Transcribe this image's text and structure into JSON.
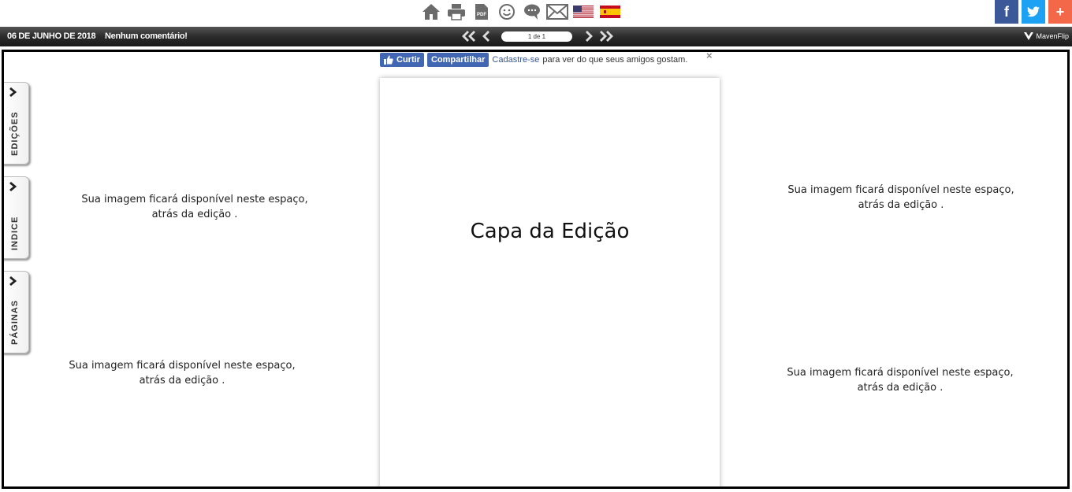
{
  "toolbar": {
    "icons": [
      "home-icon",
      "print-icon",
      "pdf-icon",
      "smiley-icon",
      "comments-icon",
      "mail-icon"
    ],
    "pdf_label": "PDF",
    "flags": [
      "us-flag",
      "es-flag"
    ]
  },
  "social": {
    "facebook": "f",
    "twitter": "t",
    "more": "+",
    "colors": {
      "facebook": "#3b5998",
      "twitter": "#1da1f2",
      "more": "#f26849"
    }
  },
  "navbar": {
    "date": "06 DE JUNHO DE 2018",
    "comments": "Nenhum comentário!",
    "page_indicator": "1 de 1",
    "brand": "MavenFlip"
  },
  "facebook_bar": {
    "like_label": "Curtir",
    "share_label": "Compartilhar",
    "signup_link": "Cadastre-se",
    "signup_text": "para ver do que seus amigos gostam.",
    "close": "×"
  },
  "side_tabs": [
    {
      "label": "EDIÇÕES"
    },
    {
      "label": "INDICE"
    },
    {
      "label": "PÁGINAS"
    }
  ],
  "page": {
    "title": "Capa da Edição"
  },
  "placeholders": {
    "top_left": {
      "line1": "Sua imagem ficará disponível neste espaço,",
      "line2": "atrás da edição ."
    },
    "bottom_left": {
      "line1": "Sua imagem ficará disponível neste espaço,",
      "line2": "atrás da edição ."
    },
    "top_right": {
      "line1": "Sua imagem ficará disponível neste espaço,",
      "line2": "atrás da edição ."
    },
    "bottom_right": {
      "line1": "Sua imagem ficará disponível neste espaço,",
      "line2": "atrás da edição ."
    }
  }
}
